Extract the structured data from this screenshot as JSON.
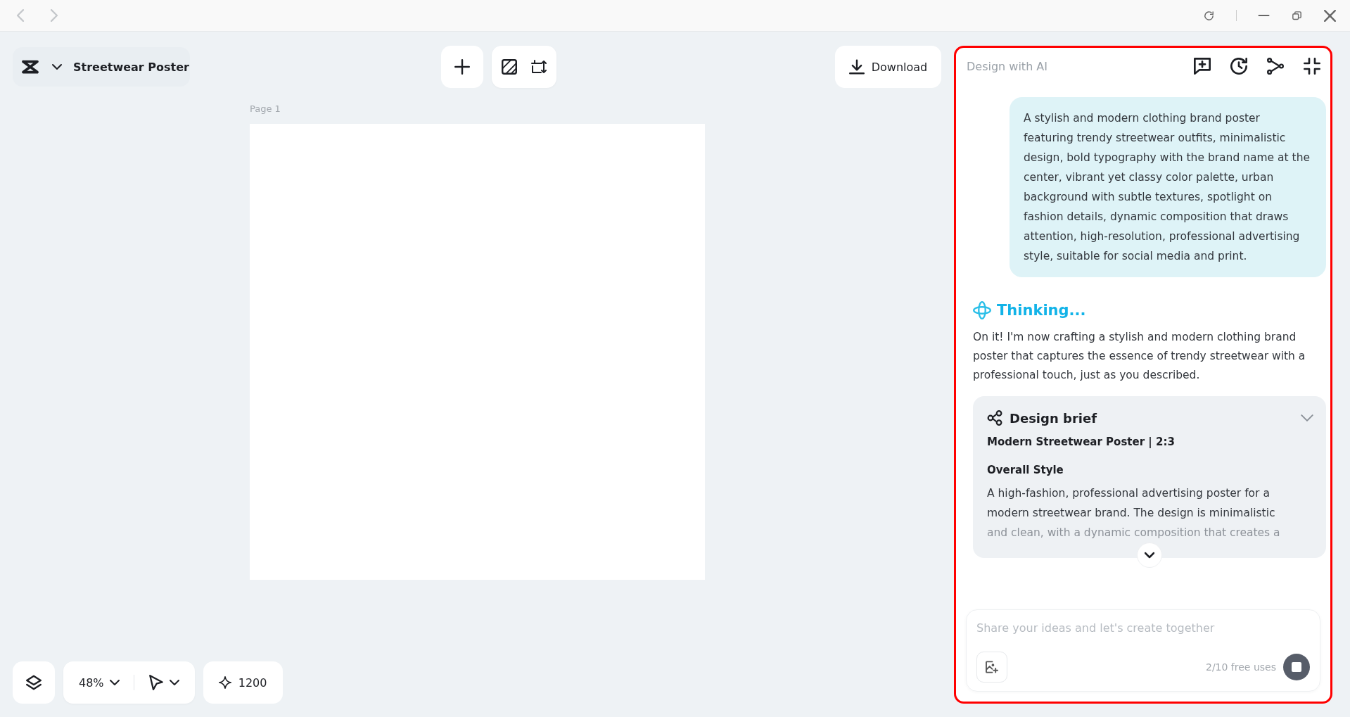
{
  "project": {
    "title": "Streetwear Poster"
  },
  "toolbar": {
    "download": "Download"
  },
  "canvas": {
    "page_label": "Page 1"
  },
  "bottom_bar": {
    "zoom": "48%",
    "credits": "1200"
  },
  "ai_panel": {
    "title": "Design with AI",
    "highlighted": true,
    "user_message": "A stylish and modern clothing brand poster featuring trendy streetwear outfits, minimalistic design, bold typography with the brand name at the center, vibrant yet classy color palette, urban background with subtle textures, spotlight on fashion details, dynamic composition that draws attention, high-resolution, professional advertising style, suitable for social media and print.",
    "status": "Thinking...",
    "reply": "On it! I'm now crafting a stylish and modern clothing brand poster that captures the essence of trendy streetwear with a professional touch, just as you described.",
    "brief": {
      "title": "Design brief",
      "expanded": false,
      "heading": "Modern Streetwear Poster | 2:3",
      "section": "Overall Style",
      "text": "A high-fashion, professional advertising poster for a modern streetwear brand. The design is minimalistic",
      "faded_text": "and clean, with a dynamic composition that creates a"
    },
    "input": {
      "placeholder": "Share your ideas and let's create together",
      "usage": "2/10 free uses",
      "generating": true
    }
  }
}
